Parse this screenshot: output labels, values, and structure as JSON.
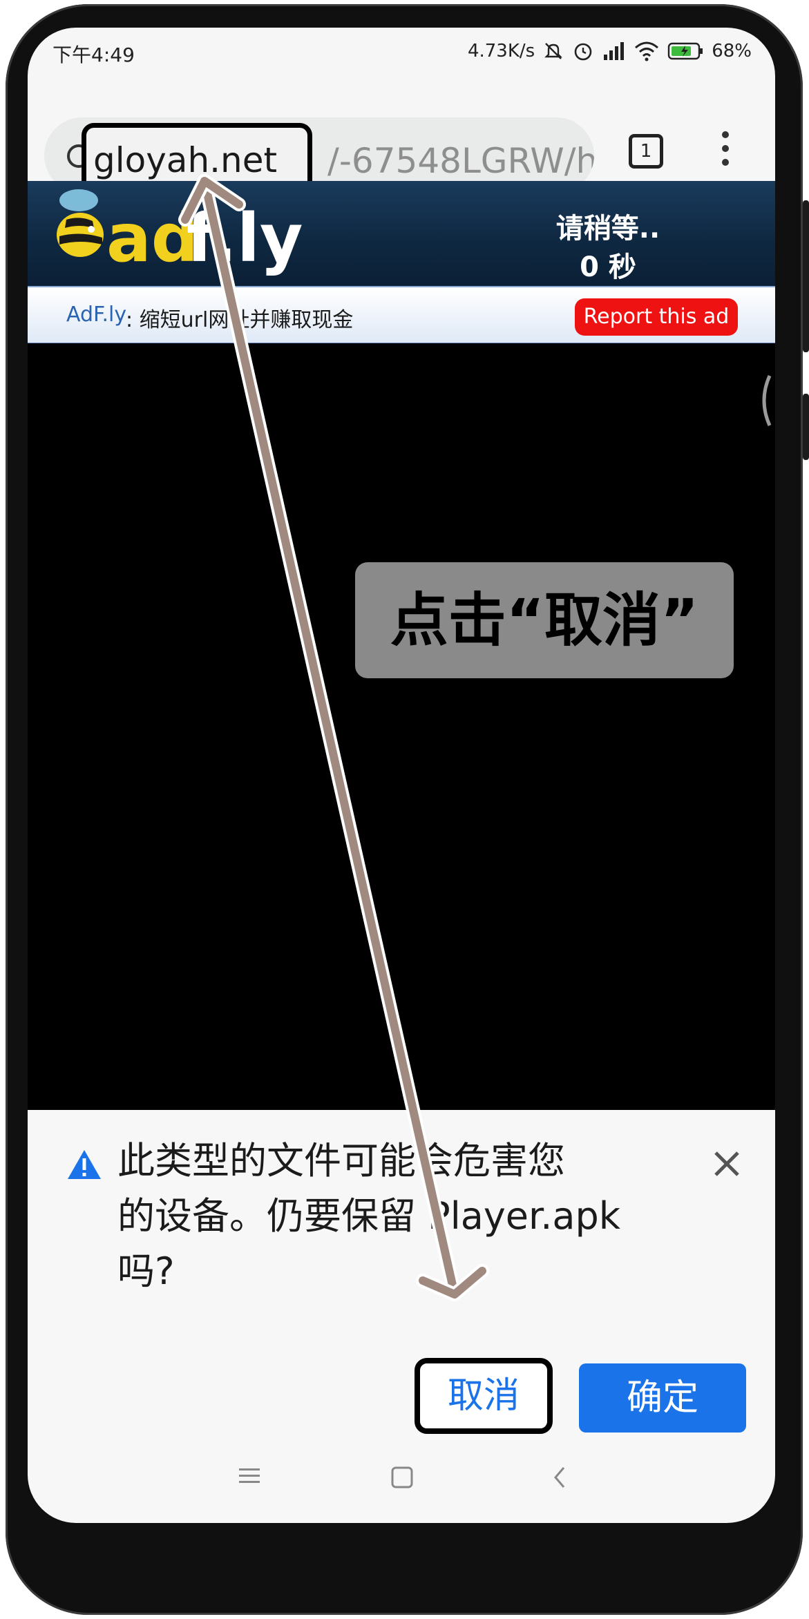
{
  "status_bar": {
    "time": "下午4:49",
    "network_speed": "4.73K/s",
    "battery": "68%",
    "icons": [
      "mute-icon",
      "alarm-icon",
      "signal-icon",
      "wifi-icon",
      "battery-icon"
    ]
  },
  "browser": {
    "url_host": "gloyah.net",
    "url_rest": "/-67548LGRW/h",
    "tab_count": "1",
    "icons": [
      "info-icon",
      "tabs-icon",
      "more-vert-icon"
    ]
  },
  "adfly": {
    "logo_text": "adf.ly",
    "wait_label": "请稍等..",
    "seconds_label": "0 秒",
    "strip_brand": "AdF.ly",
    "strip_text": " : 缩短url网址并赚取现金",
    "report_button": "Report this ad"
  },
  "overlay": {
    "instruction": "点击“取消”"
  },
  "download_dialog": {
    "line1": "此类型的文件可能会危害您",
    "line2": "的设备。仍要保留 Player.apk",
    "line3": "吗?",
    "cancel_label": "取消",
    "ok_label": "确定"
  },
  "colors": {
    "accent_blue": "#1a73e8",
    "report_red": "#ee1212",
    "arrow": "#a08a7f",
    "adfly_yellow": "#f2d01e"
  }
}
